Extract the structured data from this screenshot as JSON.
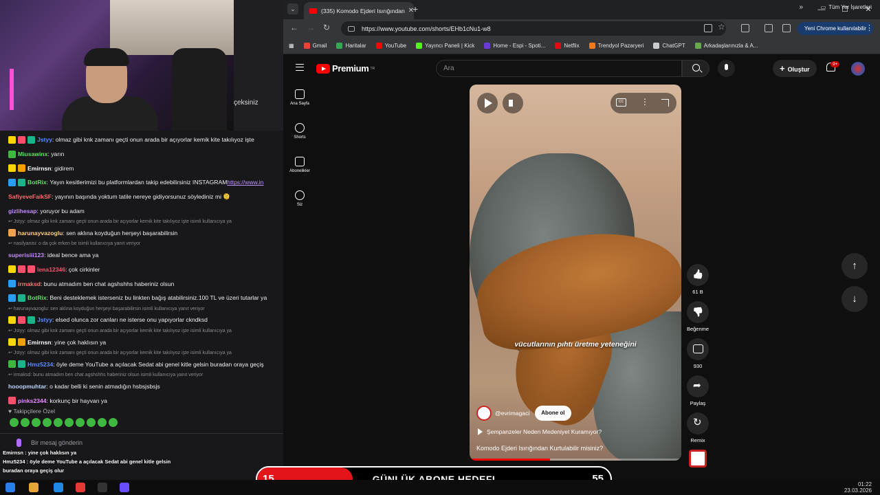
{
  "stream": {
    "cam_side_text": "çeksiniz",
    "chat_lines": [
      {
        "kind": "msg",
        "badges": [
          "#ffd700",
          "#ff4f6d",
          "#1db38a"
        ],
        "user": "Jstyy",
        "user_color": "#5b8cff",
        "text": ": olmaz gibi knk zamanı geçti onun arada bir açıyorlar kemik kite takılıyoz işte"
      },
      {
        "kind": "msg",
        "badges": [
          "#3fb83f"
        ],
        "user": "Miusawinx",
        "user_color": "#5be35b",
        "text": ": yarın"
      },
      {
        "kind": "msg",
        "badges": [
          "#ffd700",
          "#f0a000"
        ],
        "user": "Emirnsn",
        "user_color": "#ffffff",
        "text": ": gidirem"
      },
      {
        "kind": "msg",
        "badges": [
          "#2a9df4",
          "#1db38a"
        ],
        "user": "BotRix",
        "user_color": "#60e060",
        "text": ": Yayın kesitlerimizi bu platformlardan takip edebilirsiniz INSTAGRAM ",
        "link": "https://www.in"
      },
      {
        "kind": "msg",
        "badges": [],
        "user": "SafiyeveFaikSF",
        "user_color": "#ff6a6a",
        "text": ": yayının başında yoktum tatile nereye gidiyorsunuz söylediniz mi 🫠"
      },
      {
        "kind": "msg",
        "badges": [],
        "user": "gizlihesap",
        "user_color": "#c58bff",
        "text": ": yoruyor bu adam"
      },
      {
        "kind": "reply",
        "text": "↩ Jstyy: olmaz gibi knk zamanı geçti onun arada bir açıyorlar kemik kite takılıyoz işte isimli kullanıcıya ya"
      },
      {
        "kind": "msg",
        "badges": [
          "#f0a050"
        ],
        "user": "harunayvazoglu",
        "user_color": "#ffcf80",
        "text": ": sen aklına koyduğun herşeyi başarabilirsin"
      },
      {
        "kind": "reply",
        "text": "↩ nasilyanisi: o da çok erken be isimli kullanıcıya yanıt veriyor"
      },
      {
        "kind": "msg",
        "badges": [],
        "user": "superisiii123",
        "user_color": "#c58bff",
        "text": ": ideal bence ama ya"
      },
      {
        "kind": "msg",
        "badges": [
          "#ffd700",
          "#ff4f6d",
          "#ff4f6d"
        ],
        "user": "lena12346",
        "user_color": "#ff4f6d",
        "text": ": çok cirkinler"
      },
      {
        "kind": "msg",
        "badges": [
          "#2a9df4"
        ],
        "user": "irmaksd",
        "user_color": "#ff7070",
        "text": ": bunu atmadım ben chat agshshhs haberiniz olsun"
      },
      {
        "kind": "msg",
        "badges": [
          "#2a9df4",
          "#1db38a"
        ],
        "user": "BotRix",
        "user_color": "#60e060",
        "text": ": Beni desteklemek isterseniz bu linkten bağış atabilirsiniz.100 TL ve üzeri tutarlar ya"
      },
      {
        "kind": "reply",
        "text": "↩ harunayvazoglu: sen aklına koyduğun herşeyi başarabilirsin isimli kullanıcıya yanıt veriyor"
      },
      {
        "kind": "msg",
        "badges": [
          "#ffd700",
          "#ff4f6d",
          "#1db38a"
        ],
        "user": "Jstyy",
        "user_color": "#5b8cff",
        "text": ": elsed olunca zor canları ne isterse onu yapıyorlar ckndksd"
      },
      {
        "kind": "reply",
        "text": "↩ Jstyy: olmaz gibi knk zamanı geçti onun arada bir açıyorlar kemik kite takılıyoz işte isimli kullanıcıya ya"
      },
      {
        "kind": "msg",
        "badges": [
          "#ffd700",
          "#f0a000"
        ],
        "user": "Emirnsn",
        "user_color": "#ffffff",
        "text": ": yine çok haklısın ya"
      },
      {
        "kind": "reply",
        "text": "↩ Jstyy: olmaz gibi knk zamanı geçti onun arada bir açıyorlar kemik kite takılıyoz işte isimli kullanıcıya ya"
      },
      {
        "kind": "msg",
        "badges": [
          "#3fb83f",
          "#1db38a"
        ],
        "user": "Hmz5234",
        "user_color": "#5b8cff",
        "text": ": öyle deme YouTube a açılacak Sedat abi genel kitle gelsin buradan oraya geçiş"
      },
      {
        "kind": "reply",
        "text": "↩ irmaksd: bunu atmadım ben chat agshshhs haberiniz olsun isimli kullanıcıya yanıt veriyor"
      },
      {
        "kind": "msg",
        "badges": [],
        "user": "hooopmuhtar",
        "user_color": "#bcd6ff",
        "text": ": o kadar belli ki senin atmadığın hsbsjsbsjs"
      },
      {
        "kind": "msg",
        "badges": [
          "#ff4f6d"
        ],
        "user": "pinks2344",
        "user_color": "#e58bff",
        "text": ": korkunç bir hayvan ya"
      }
    ],
    "follower_label": "♥ Takipçilere Özel",
    "chat_input_placeholder": "Bir mesaj gönderin",
    "overlay": [
      "Emirnsn : yine çok haklısın ya",
      "Hmz5234 : öyle deme YouTube a açılacak Sedat abi genel kitle gelsin",
      "buradan oraya geçiş olur"
    ],
    "sub_goal": {
      "label": "GÜNLÜK ABONE HEDEFI",
      "current": "15",
      "target": "55",
      "fill": 0.27
    }
  },
  "clock": {
    "time": "01:22",
    "date": "23.03.2026"
  },
  "browser": {
    "tab_title": "(335) Komodo Ejderi Isırığından",
    "url": "https://www.youtube.com/shorts/EHb1cNu1-w8",
    "chrome_button": "Yeni Chrome kullanılabilir",
    "bookmarks": [
      {
        "label": "Gmail",
        "color": "#ea4335"
      },
      {
        "label": "Haritalar",
        "color": "#34a853"
      },
      {
        "label": "YouTube",
        "color": "#ff0000"
      },
      {
        "label": "Yayıncı Paneli | Kick",
        "color": "#53fc18"
      },
      {
        "label": "Home - Espi - Spoti...",
        "color": "#6b3bd6"
      },
      {
        "label": "Netflix",
        "color": "#e50914"
      },
      {
        "label": "Trendyol Pazaryeri",
        "color": "#f27a1a"
      },
      {
        "label": "ChatGPT",
        "color": "#cccccc"
      },
      {
        "label": "Arkadaşlarınızla & A...",
        "color": "#6aa84f"
      }
    ],
    "all_bookmarks": "Tüm Yer İşaretleri"
  },
  "youtube": {
    "brand": "Premium",
    "brand_sup": "TR",
    "search_placeholder": "Ara",
    "create_label": "Oluştur",
    "notif_count": "9+",
    "sidebar": [
      {
        "label": "Ana Sayfa",
        "icon": "home-icon"
      },
      {
        "label": "Shorts",
        "icon": "shorts-icon"
      },
      {
        "label": "Abonelikler",
        "icon": "subscriptions-icon"
      },
      {
        "label": "Siz",
        "icon": "you-icon"
      }
    ],
    "short": {
      "caption": "vücutlarının pıhtı üretme yeteneğini",
      "channel": "@evrimagaci",
      "subscribe": "Abone ol",
      "related": "Şempanzeler Neden Medeniyet Kuramıyor?",
      "title": "Komodo Ejderi Isırığından Kurtulabilir misiniz?",
      "cc": "CC",
      "progress": 0.38
    },
    "actions": {
      "likes": "61 B",
      "dislike": "Beğenme",
      "comments": "930",
      "share": "Paylaş",
      "remix": "Remix"
    }
  }
}
